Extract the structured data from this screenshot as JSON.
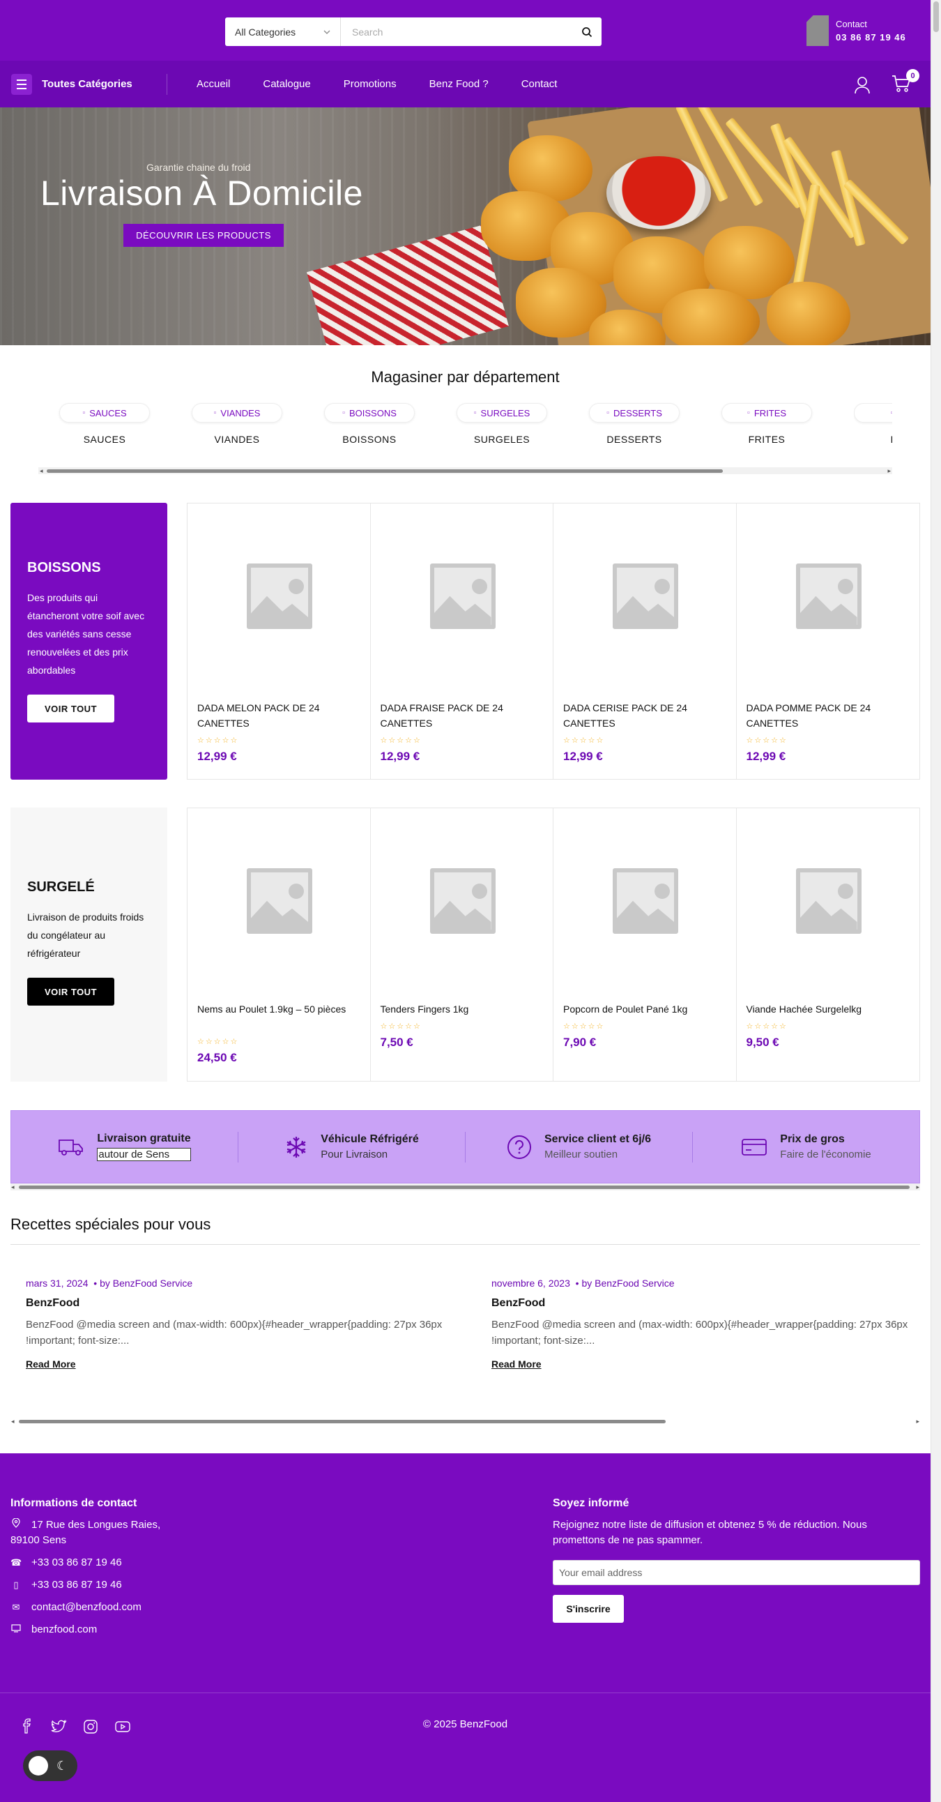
{
  "header": {
    "category_select": "All Categories",
    "search_placeholder": "Search",
    "contact_label": "Contact",
    "contact_phone": "03 86 87 19 46"
  },
  "nav": {
    "all_categories": "Toutes Catégories",
    "links": [
      "Accueil",
      "Catalogue",
      "Promotions",
      "Benz Food ?",
      "Contact"
    ],
    "cart_count": "0"
  },
  "hero": {
    "subtitle": "Garantie chaine du froid",
    "title": "Livraison À Domicile",
    "button": "DÉCOUVRIR LES PRODUCTS"
  },
  "departments": {
    "title": "Magasiner par département",
    "items": [
      {
        "pill": "SAUCES",
        "name": "SAUCES"
      },
      {
        "pill": "VIANDES",
        "name": "VIANDES"
      },
      {
        "pill": "BOISSONS",
        "name": "BOISSONS"
      },
      {
        "pill": "SURGELES",
        "name": "SURGELES"
      },
      {
        "pill": "DESSERTS",
        "name": "DESSERTS"
      },
      {
        "pill": "FRITES",
        "name": "FRITES"
      },
      {
        "pill": "Fé",
        "name": "Féc"
      }
    ]
  },
  "section_boissons": {
    "title": "BOISSONS",
    "description": "Des produits qui étancheront votre soif avec des variétés sans cesse renouvelées et des prix abordables",
    "button": "VOIR TOUT",
    "products": [
      {
        "name": "DADA MELON PACK DE 24 CANETTES",
        "price": "12,99 €"
      },
      {
        "name": "DADA FRAISE PACK DE 24 CANETTES",
        "price": "12,99 €"
      },
      {
        "name": "DADA CERISE PACK DE 24 CANETTES",
        "price": "12,99 €"
      },
      {
        "name": "DADA POMME PACK DE 24 CANETTES",
        "price": "12,99 €"
      }
    ]
  },
  "section_surgele": {
    "title": "SURGELÉ",
    "description": "Livraison de produits froids du congélateur au réfrigérateur",
    "button": "VOIR TOUT",
    "products": [
      {
        "name": "Nems au Poulet 1.9kg – 50 pièces",
        "price": "24,50 €"
      },
      {
        "name": "Tenders Fingers 1kg",
        "price": "7,50 €"
      },
      {
        "name": "Popcorn de Poulet Pané 1kg",
        "price": "7,90 €"
      },
      {
        "name": "Viande Hachée Surgelelkg",
        "price": "9,50 €"
      }
    ]
  },
  "stars": "☆☆☆☆☆",
  "features": [
    {
      "title": "Livraison gratuite",
      "sub": "autour de Sens",
      "icon": "truck-icon"
    },
    {
      "title": "Véhicule Réfrigéré",
      "sub": "Pour Livraison",
      "icon": "snowflake-icon"
    },
    {
      "title": "Service client et 6j/6",
      "sub": "Meilleur soutien",
      "icon": "question-icon"
    },
    {
      "title": "Prix de gros",
      "sub": "Faire de l'économie",
      "icon": "card-icon"
    }
  ],
  "blog": {
    "title": "Recettes spéciales pour vous",
    "posts": [
      {
        "date": "mars 31, 2024",
        "author": "by BenzFood Service",
        "title": "BenzFood",
        "excerpt": "BenzFood @media screen and (max-width: 600px){#header_wrapper{padding: 27px 36px !important; font-size:...",
        "read_more": "Read More"
      },
      {
        "date": "novembre 6, 2023",
        "author": "by BenzFood Service",
        "title": "BenzFood",
        "excerpt": "BenzFood @media screen and (max-width: 600px){#header_wrapper{padding: 27px 36px !important; font-size:...",
        "read_more": "Read More"
      }
    ]
  },
  "footer": {
    "contact_title": "Informations de contact",
    "address": "17 Rue des Longues Raies, 89100 Sens",
    "phone1": "+33 03 86 87 19 46",
    "phone2": "+33 03 86 87 19 46",
    "email": "contact@benzfood.com",
    "website": "benzfood.com",
    "news_title": "Soyez informé",
    "news_text": "Rejoignez notre liste de diffusion et obtenez 5 % de réduction. Nous promettons de ne pas spammer.",
    "email_placeholder": "Your email address",
    "subscribe": "S'inscrire",
    "copyright": "© 2025 BenzFood"
  },
  "colors": {
    "brand": "#7a0bc0",
    "nav": "#6c08b3",
    "features_bg": "#c9a2f6",
    "star": "#f2b01e"
  }
}
